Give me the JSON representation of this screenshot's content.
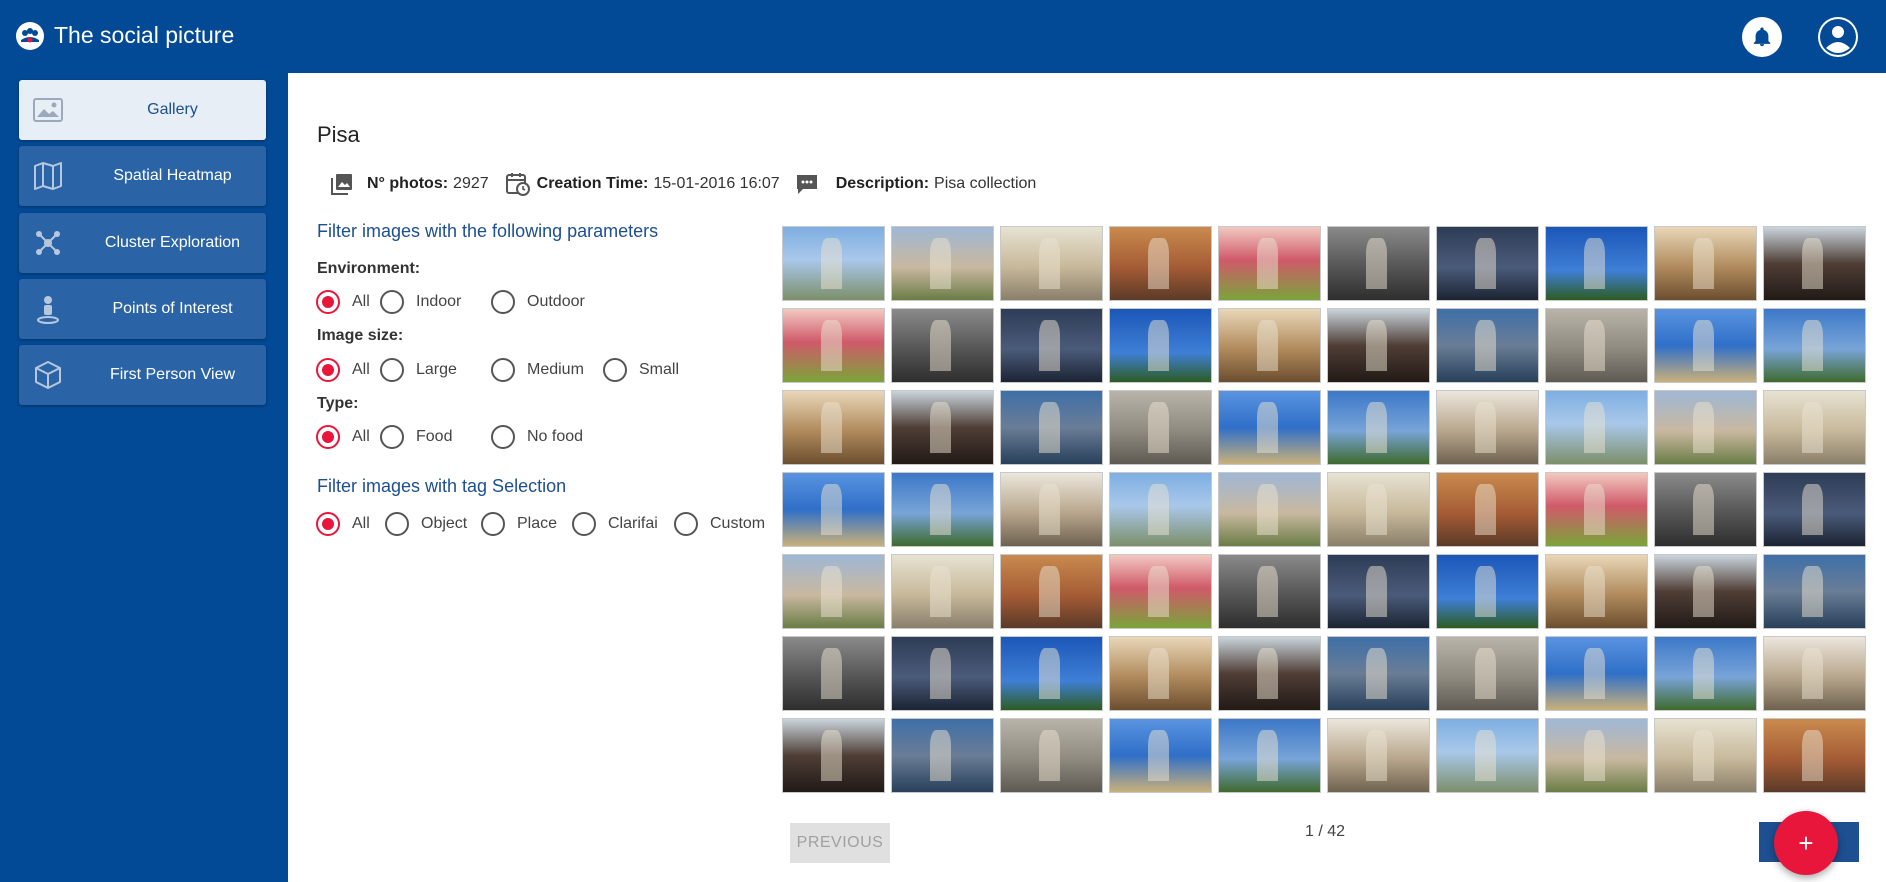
{
  "app": {
    "title": "The social picture",
    "logo_icon": "social-picture-logo-icon",
    "primary_color": "#034a96",
    "accent_color": "#e8163a"
  },
  "topbar": {
    "notifications_icon": "bell-icon",
    "account_icon": "account-circle-icon"
  },
  "sidebar": {
    "items": [
      {
        "label": "Gallery",
        "icon": "image-icon",
        "active": true
      },
      {
        "label": "Spatial Heatmap",
        "icon": "map-icon",
        "active": false
      },
      {
        "label": "Cluster Exploration",
        "icon": "cluster-icon",
        "active": false
      },
      {
        "label": "Points of Interest",
        "icon": "person-pin-icon",
        "active": false
      },
      {
        "label": "First Person View",
        "icon": "cube-icon",
        "active": false
      }
    ]
  },
  "collection": {
    "title": "Pisa",
    "photos_label": "N° photos:",
    "photos_value": "2927",
    "creation_label": "Creation Time:",
    "creation_value": "15-01-2016 16:07",
    "description_label": "Description:",
    "description_value": "Pisa collection"
  },
  "filters": {
    "title": "Filter images with the following parameters",
    "environment": {
      "label": "Environment:",
      "options": [
        "All",
        "Indoor",
        "Outdoor"
      ],
      "selected": "All"
    },
    "image_size": {
      "label": "Image size:",
      "options": [
        "All",
        "Large",
        "Medium",
        "Small"
      ],
      "selected": "All"
    },
    "type": {
      "label": "Type:",
      "options": [
        "All",
        "Food",
        "No food"
      ],
      "selected": "All"
    },
    "tag_title": "Filter images with tag Selection",
    "tag": {
      "options": [
        "All",
        "Object",
        "Place",
        "Clarifai",
        "Custom"
      ],
      "selected": "All"
    }
  },
  "gallery": {
    "rows": 7,
    "columns": 10,
    "count": 70
  },
  "pagination": {
    "previous_label": "PREVIOUS",
    "current_page": "1 / 42",
    "fab_label": "+"
  }
}
